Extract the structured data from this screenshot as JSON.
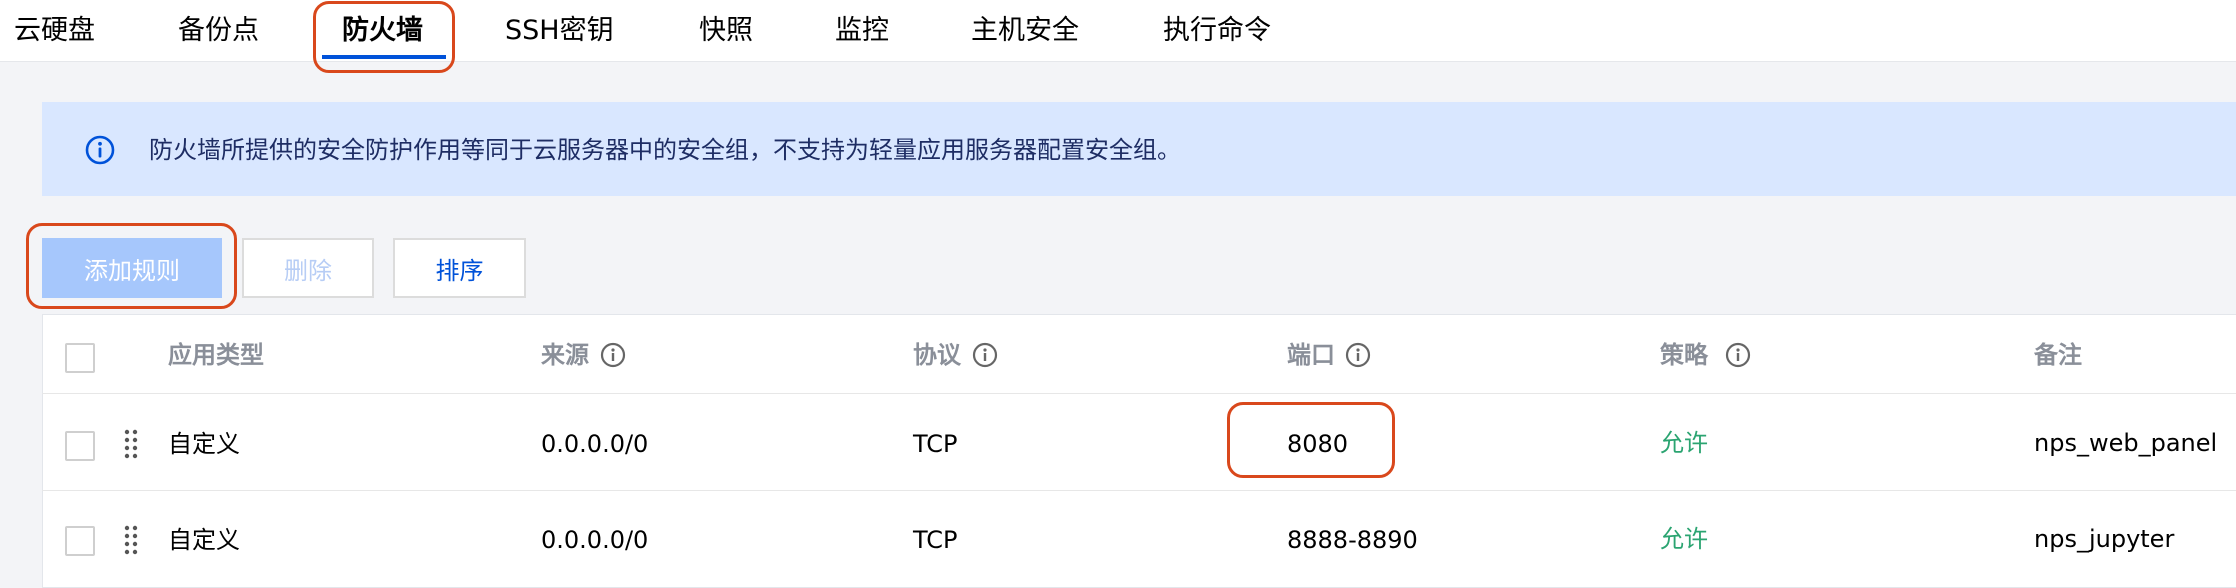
{
  "tabs": [
    {
      "label": "云硬盘"
    },
    {
      "label": "备份点"
    },
    {
      "label": "防火墙"
    },
    {
      "label": "SSH密钥"
    },
    {
      "label": "快照"
    },
    {
      "label": "监控"
    },
    {
      "label": "主机安全"
    },
    {
      "label": "执行命令"
    }
  ],
  "active_tab": "防火墙",
  "notice": {
    "icon": "info-icon",
    "text": "防火墙所提供的安全防护作用等同于云服务器中的安全组，不支持为轻量应用服务器配置安全组。"
  },
  "toolbar": {
    "add_label": "添加规则",
    "delete_label": "删除",
    "sort_label": "排序"
  },
  "table": {
    "columns": [
      "应用类型",
      "来源",
      "协议",
      "端口",
      "策略",
      "备注"
    ],
    "rows": [
      {
        "type": "自定义",
        "source": "0.0.0.0/0",
        "protocol": "TCP",
        "port": "8080",
        "policy": "允许",
        "note": "nps_web_panel"
      },
      {
        "type": "自定义",
        "source": "0.0.0.0/0",
        "protocol": "TCP",
        "port": "8888-8890",
        "policy": "允许",
        "note": "nps_jupyter"
      }
    ]
  },
  "colors": {
    "accent": "#0052d9",
    "highlight": "#d9481c",
    "allow": "#2ba471",
    "notice_bg": "#d9e7ff"
  }
}
